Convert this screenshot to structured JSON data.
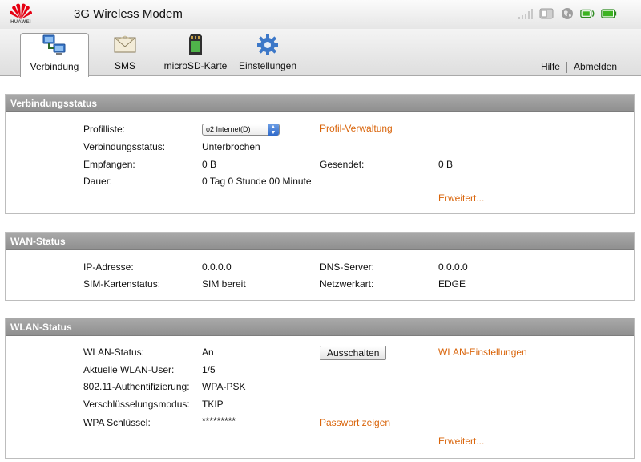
{
  "header": {
    "brand": "HUAWEI",
    "title": "3G Wireless Modem",
    "status_icons": [
      "signal-strength-icon",
      "sim-card-icon",
      "globe-icon",
      "wifi-icon",
      "battery-icon"
    ]
  },
  "tabs": [
    {
      "label": "Verbindung",
      "icon": "network-computers-icon",
      "active": true
    },
    {
      "label": "SMS",
      "icon": "envelope-icon",
      "active": false
    },
    {
      "label": "microSD-Karte",
      "icon": "memory-card-icon",
      "active": false
    },
    {
      "label": "Einstellungen",
      "icon": "gear-icon",
      "active": false
    }
  ],
  "top_links": {
    "help": "Hilfe",
    "logout": "Abmelden"
  },
  "connection": {
    "title": "Verbindungsstatus",
    "profile_label": "Profilliste:",
    "profile_value": "o2 Internet(D)",
    "profile_link": "Profil-Verwaltung",
    "status_label": "Verbindungsstatus:",
    "status_value": "Unterbrochen",
    "received_label": "Empfangen:",
    "received_value": "0 B",
    "sent_label": "Gesendet:",
    "sent_value": "0 B",
    "duration_label": "Dauer:",
    "duration_value": "0 Tag 0 Stunde 00 Minute",
    "advanced_link": "Erweitert..."
  },
  "wan": {
    "title": "WAN-Status",
    "ip_label": "IP-Adresse:",
    "ip_value": "0.0.0.0",
    "dns_label": "DNS-Server:",
    "dns_value": "0.0.0.0",
    "sim_label": "SIM-Kartenstatus:",
    "sim_value": "SIM bereit",
    "network_label": "Netzwerkart:",
    "network_value": "EDGE"
  },
  "wlan": {
    "title": "WLAN-Status",
    "status_label": "WLAN-Status:",
    "status_value": "An",
    "toggle_button": "Ausschalten",
    "settings_link": "WLAN-Einstellungen",
    "users_label": "Aktuelle WLAN-User:",
    "users_value": "1/5",
    "auth_label": "802.11-Authentifizierung:",
    "auth_value": "WPA-PSK",
    "encryption_label": "Verschlüsselungsmodus:",
    "encryption_value": "TKIP",
    "key_label": "WPA Schlüssel:",
    "key_value": "*********",
    "show_password_link": "Passwort zeigen",
    "advanced_link": "Erweitert..."
  },
  "colors": {
    "link": "#d9640a",
    "panel_header": "#9c9c9c",
    "brand_red": "#e60012"
  }
}
